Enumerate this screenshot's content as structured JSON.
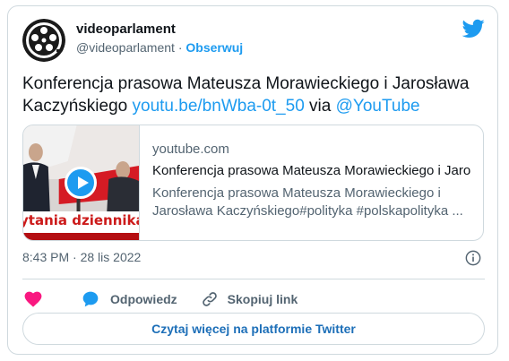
{
  "author": {
    "name": "videoparlament",
    "handle": "@videoparlament",
    "separator": "·",
    "follow_label": "Obserwuj"
  },
  "tweet": {
    "text_part1": "Konferencja prasowa Mateusza Morawieckiego i Jarosława Kaczyńskiego ",
    "link": "youtu.be/bnWba-0t_50",
    "via": " via ",
    "mention": "@YouTube"
  },
  "preview": {
    "domain": "youtube.com",
    "title": "Konferencja prasowa Mateusza Morawieckiego i Jaro...",
    "description": "Konferencja prasowa Mateusza Morawieckiego i Jarosława Kaczyńskiego#polityka #polskapolityka ...",
    "thumbnail_caption": "ytania dziennikarzy"
  },
  "meta": {
    "timestamp": "8:43 PM · 28 lis 2022"
  },
  "actions": {
    "reply_label": "Odpowiedz",
    "copy_label": "Skopiuj link"
  },
  "cta_label": "Czytaj więcej na platformie Twitter",
  "icons": {
    "brand": "twitter-bird-icon",
    "like": "heart-icon",
    "reply": "speech-bubble-icon",
    "copy": "link-icon",
    "info": "info-icon",
    "play": "play-icon"
  },
  "colors": {
    "accent": "#1d9bf0",
    "heart": "#f91880",
    "text": "#0f1419",
    "muted": "#536471",
    "border": "#cfd9de"
  }
}
